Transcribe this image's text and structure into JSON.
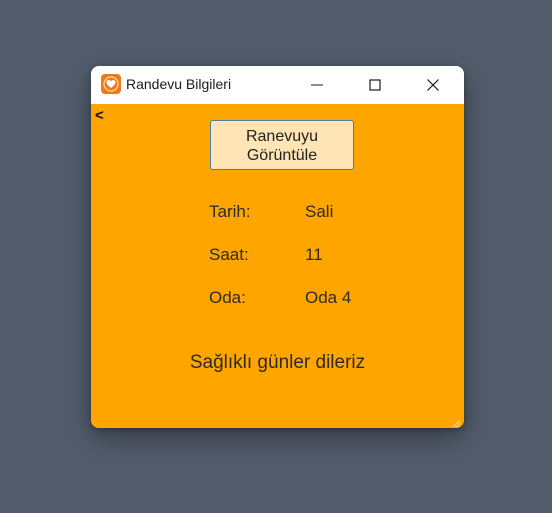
{
  "window": {
    "title": "Randevu Bilgileri",
    "icon": "heart-app-icon",
    "controls": [
      "minimize-icon",
      "maximize-icon",
      "close-icon"
    ]
  },
  "nav": {
    "back_label": "<"
  },
  "view_button": {
    "line1": "Ranevuyu",
    "line2": "Görüntüle"
  },
  "details": [
    {
      "label": "Tarih:",
      "value": "Sali"
    },
    {
      "label": "Saat:",
      "value": "11"
    },
    {
      "label": "Oda:",
      "value": "Oda 4"
    }
  ],
  "footer": {
    "message": "Sağlıklı günler dileriz"
  },
  "colors": {
    "desktop": "#525c6b",
    "content_background": "#ffa500",
    "button_background": "#ffe4b5",
    "button_border": "#4a7fa8",
    "app_icon": "#f07a1a"
  }
}
